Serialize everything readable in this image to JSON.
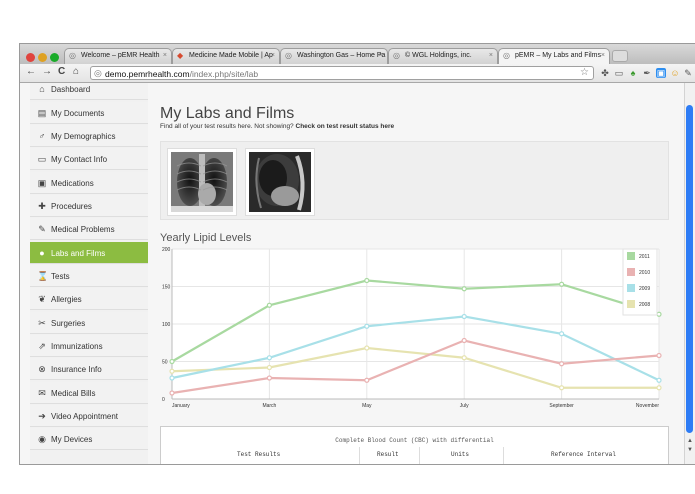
{
  "browser": {
    "tabs": [
      {
        "title": "Welcome – pEMR Health",
        "icon": "globe-icon"
      },
      {
        "title": "Medicine Made Mobile | Ap",
        "icon": "colored-favicon"
      },
      {
        "title": "Washington Gas – Home Pa",
        "icon": "globe-icon"
      },
      {
        "title": "© WGL Holdings, inc.",
        "icon": "globe-icon"
      },
      {
        "title": "pEMR – My Labs and Films",
        "icon": "globe-icon"
      }
    ],
    "url": "demo.pemrhealth.com/index.php/site/lab",
    "url_host": "demo.pemrhealth.com",
    "url_path": "/index.php/site/lab",
    "back_glyph": "←",
    "forward_glyph": "→",
    "reload_glyph": "C",
    "home_glyph": "⌂",
    "star_glyph": "☆",
    "close_glyph": "×",
    "scroll_up_glyph": "▲",
    "scroll_down_glyph": "▼"
  },
  "sidebar": {
    "items": [
      {
        "label": "Dashboard",
        "icon": "home-icon",
        "glyph": "⌂",
        "active": false
      },
      {
        "label": "My Documents",
        "icon": "document-icon",
        "glyph": "▤",
        "active": false
      },
      {
        "label": "My Demographics",
        "icon": "gender-icon",
        "glyph": "♂",
        "active": false
      },
      {
        "label": "My Contact Info",
        "icon": "contact-card-icon",
        "glyph": "▭",
        "active": false
      },
      {
        "label": "Medications",
        "icon": "medication-icon",
        "glyph": "▣",
        "active": false
      },
      {
        "label": "Procedures",
        "icon": "plus-icon",
        "glyph": "✚",
        "active": false
      },
      {
        "label": "Medical Problems",
        "icon": "bandage-icon",
        "glyph": "✎",
        "active": false
      },
      {
        "label": "Labs and Films",
        "icon": "labs-icon",
        "glyph": "●",
        "active": true
      },
      {
        "label": "Tests",
        "icon": "hourglass-icon",
        "glyph": "⌛",
        "active": false
      },
      {
        "label": "Allergies",
        "icon": "allergy-icon",
        "glyph": "❦",
        "active": false
      },
      {
        "label": "Surgeries",
        "icon": "scissors-icon",
        "glyph": "✂",
        "active": false
      },
      {
        "label": "Immunizations",
        "icon": "syringe-icon",
        "glyph": "⇗",
        "active": false
      },
      {
        "label": "Insurance Info",
        "icon": "insurance-icon",
        "glyph": "⊗",
        "active": false
      },
      {
        "label": "Medical Bills",
        "icon": "bill-icon",
        "glyph": "✉",
        "active": false
      },
      {
        "label": "Video Appointment",
        "icon": "arrow-right-icon",
        "glyph": "➔",
        "active": false
      },
      {
        "label": "My Devices",
        "icon": "devices-icon",
        "glyph": "◉",
        "active": false
      }
    ]
  },
  "page": {
    "title": "My Labs and Films",
    "subtitle_prefix": "Find all of your test results here. Not showing?",
    "subtitle_link": "Check on test result status here"
  },
  "films": [
    {
      "name": "chest-xray-frontal",
      "kind": "frontal"
    },
    {
      "name": "chest-xray-lateral",
      "kind": "lateral"
    }
  ],
  "lipids_title": "Yearly Lipid Levels",
  "chart_data": {
    "type": "line",
    "title": "Yearly Lipid Levels",
    "x": [
      "January",
      "March",
      "May",
      "July",
      "September",
      "November"
    ],
    "ylim": [
      0,
      200
    ],
    "yticks": [
      0,
      50,
      100,
      150,
      200
    ],
    "grid": true,
    "legend_position": "top-right",
    "series": [
      {
        "name": "2011",
        "color": "#a8d9a0",
        "values": [
          50,
          125,
          158,
          147,
          153,
          113
        ]
      },
      {
        "name": "2010",
        "color": "#e9b2b2",
        "values": [
          8,
          28,
          25,
          78,
          47,
          58
        ]
      },
      {
        "name": "2009",
        "color": "#a8e0e8",
        "values": [
          28,
          55,
          97,
          110,
          87,
          25
        ]
      },
      {
        "name": "2008",
        "color": "#e6e3b0",
        "values": [
          37,
          42,
          68,
          55,
          15,
          15
        ]
      }
    ]
  },
  "cbc": {
    "title": "Complete Blood Count (CBC) with differential",
    "columns": [
      "Test Results",
      "Result",
      "Units",
      "Reference Interval"
    ]
  },
  "colors": {
    "accent": "#8cbc41",
    "scroll_thumb": "#2d7cf5"
  }
}
